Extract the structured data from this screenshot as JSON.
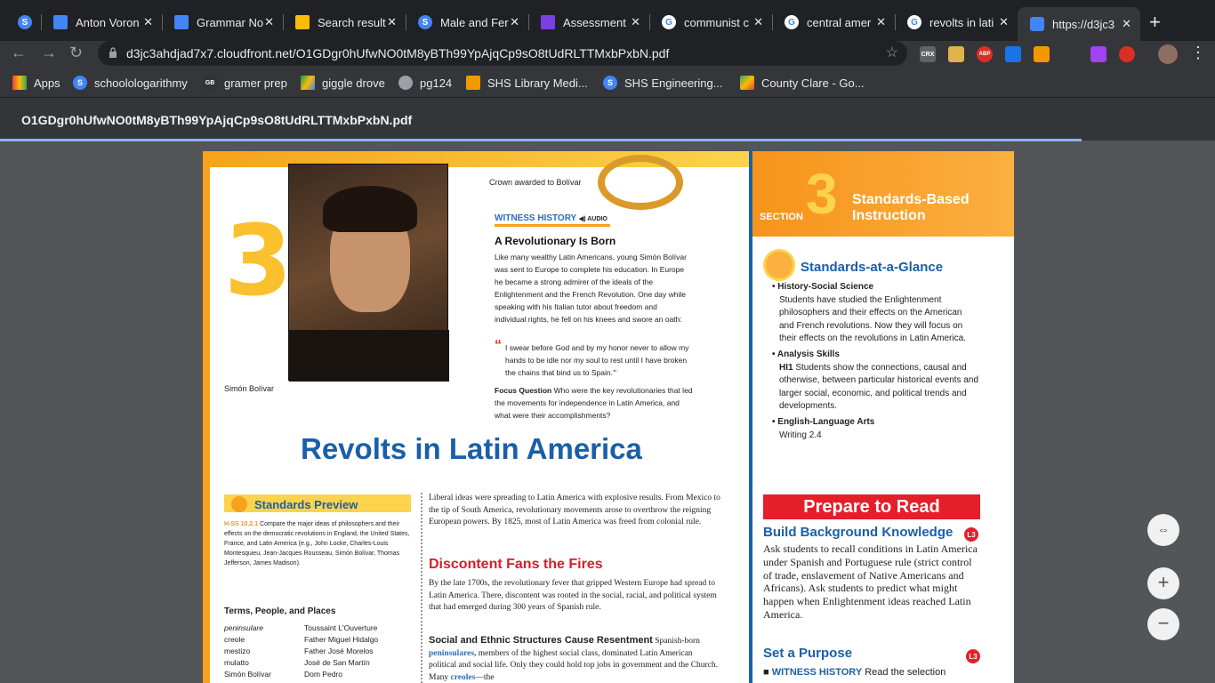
{
  "browser": {
    "tabs": [
      {
        "title": "",
        "icon": "schoology-icon",
        "color": "#4285f4"
      },
      {
        "title": "Anton Voron",
        "icon": "docs-icon",
        "color": "#4285f4"
      },
      {
        "title": "Grammar No",
        "icon": "docs-icon",
        "color": "#4285f4"
      },
      {
        "title": "Search result",
        "icon": "drive-icon",
        "color": "#fbbc04"
      },
      {
        "title": "Male and Fer",
        "icon": "schoology-icon",
        "color": "#4285f4"
      },
      {
        "title": "Assessment",
        "icon": "forms-icon",
        "color": "#7b3fe4"
      },
      {
        "title": "communist c",
        "icon": "google-icon",
        "color": "#4285f4"
      },
      {
        "title": "central amer",
        "icon": "google-icon",
        "color": "#4285f4"
      },
      {
        "title": "revolts in lati",
        "icon": "google-icon",
        "color": "#4285f4"
      },
      {
        "title": "https://d3jc3",
        "icon": "map-pin-icon",
        "color": "#4285f4"
      }
    ],
    "url": "d3jc3ahdjad7x7.cloudfront.net/O1GDgr0hUfwNO0tM8yBTh99YpAjqCp9sO8tUdRLTTMxbPxbN.pdf",
    "bookmarks": [
      {
        "label": "Apps",
        "icon": "apps-grid-icon"
      },
      {
        "label": "schoolologarithmy",
        "icon": "schoology-icon"
      },
      {
        "label": "gramer prep",
        "icon": "gb-icon"
      },
      {
        "label": "giggle drove",
        "icon": "drive-icon"
      },
      {
        "label": "pg124",
        "icon": "globe-icon"
      },
      {
        "label": "SHS Library Medi...",
        "icon": "library-icon"
      },
      {
        "label": "SHS Engineering...",
        "icon": "schoology-icon"
      },
      {
        "label": "County Clare - Go...",
        "icon": "maps-icon"
      }
    ],
    "extensions": [
      "CRX",
      "ABP"
    ]
  },
  "pdf": {
    "filename": "O1GDgr0hUfwNO0tM8yBTh99YpAjqCp9sO8tUdRLTTMxbPxbN.pdf"
  },
  "page": {
    "section_vertical": "SECTION",
    "section_number": "3",
    "portrait_caption": "Simón Bolívar",
    "crown_caption": "Crown awarded to Bolívar",
    "witness_history": "WITNESS HISTORY",
    "audio": "AUDIO",
    "rev_heading": "A Revolutionary Is Born",
    "rev_body": "Like many wealthy Latin Americans, young Simón Bolívar was sent to Europe to complete his education. In Europe he became a strong admirer of the ideals of the Enlightenment and the French Revolution. One day while speaking with his Italian tutor about freedom and individual rights, he fell on his knees and swore an oath:",
    "quote": "I swear before God and by my honor never to allow my hands to be idle nor my soul to rest until I have broken the chains that bind us to Spain.",
    "focus_label": "Focus Question",
    "focus_text": "Who were the key revolutionaries that led the movements for independence in Latin America, and what were their accomplishments?",
    "main_title": "Revolts in Latin America",
    "standards_preview": "Standards Preview",
    "standards_code": "H-SS 10.2.1",
    "standards_text": "Compare the major ideas of philosophers and their effects on the democratic revolutions in England, the United States, France, and Latin America (e.g., John Locke, Charles-Louis Montesquieu, Jean-Jacques Rousseau, Simón Bolívar, Thomas Jefferson, James Madison).",
    "terms_heading": "Terms, People, and Places",
    "terms": [
      "peninsulare",
      "Toussaint L'Ouverture",
      "creole",
      "Father Miguel Hidalgo",
      "mestizo",
      "Father José Morelos",
      "mulatto",
      "José de San Martín",
      "Simón Bolívar",
      "Dom Pedro"
    ],
    "intro": "Liberal ideas were spreading to Latin America with explosive results. From Mexico to the tip of South America, revolutionary movements arose to overthrow the reigning European powers. By 1825, most of Latin America was freed from colonial rule.",
    "discontent_heading": "Discontent Fans the Fires",
    "discontent_body": "By the late 1700s, the revolutionary fever that gripped Western Europe had spread to Latin America. There, discontent was rooted in the social, racial, and political system that had emerged during 300 years of Spanish rule.",
    "social_heading": "Social and Ethnic Structures Cause Resentment",
    "social_body_a": "Spanish-born",
    "social_term1": "peninsulares,",
    "social_body_b": "members of the highest social class, dominated Latin American political and social life. Only they could hold top jobs in government and the Church. Many",
    "social_term2": "creoles",
    "social_body_c": "—the",
    "right_section": "SECTION",
    "right_number": "3",
    "right_title_1": "Standards-Based",
    "right_title_2": "Instruction",
    "sag_title": "Standards-at-a-Glance",
    "hss_label": "History-Social Science",
    "hss_text": "Students have studied the Enlightenment philosophers and their effects on the American and French revolutions. Now they will focus on their effects on the revolutions in Latin America.",
    "analysis_label": "Analysis Skills",
    "analysis_code": "HI1",
    "analysis_text": "Students show the connections, causal and otherwise, between particular historical events and larger social, economic, and political trends and developments.",
    "ela_label": "English-Language Arts",
    "ela_text": "Writing 2.4",
    "prepare": "Prepare to Read",
    "bbk_title": "Build Background Knowledge",
    "l3": "L3",
    "bbk_text": "Ask students to recall conditions in Latin America under Spanish and Portuguese rule (strict control of trade, enslavement of Native Americans and Africans). Ask students to predict what might happen when Enlightenment ideas reached Latin America.",
    "set_purpose": "Set a Purpose",
    "wh_line_label": "WITNESS HISTORY",
    "wh_line_text": "Read the selection"
  },
  "controls": {
    "fit": "⇔",
    "zoom_in": "+",
    "zoom_out": "−"
  }
}
